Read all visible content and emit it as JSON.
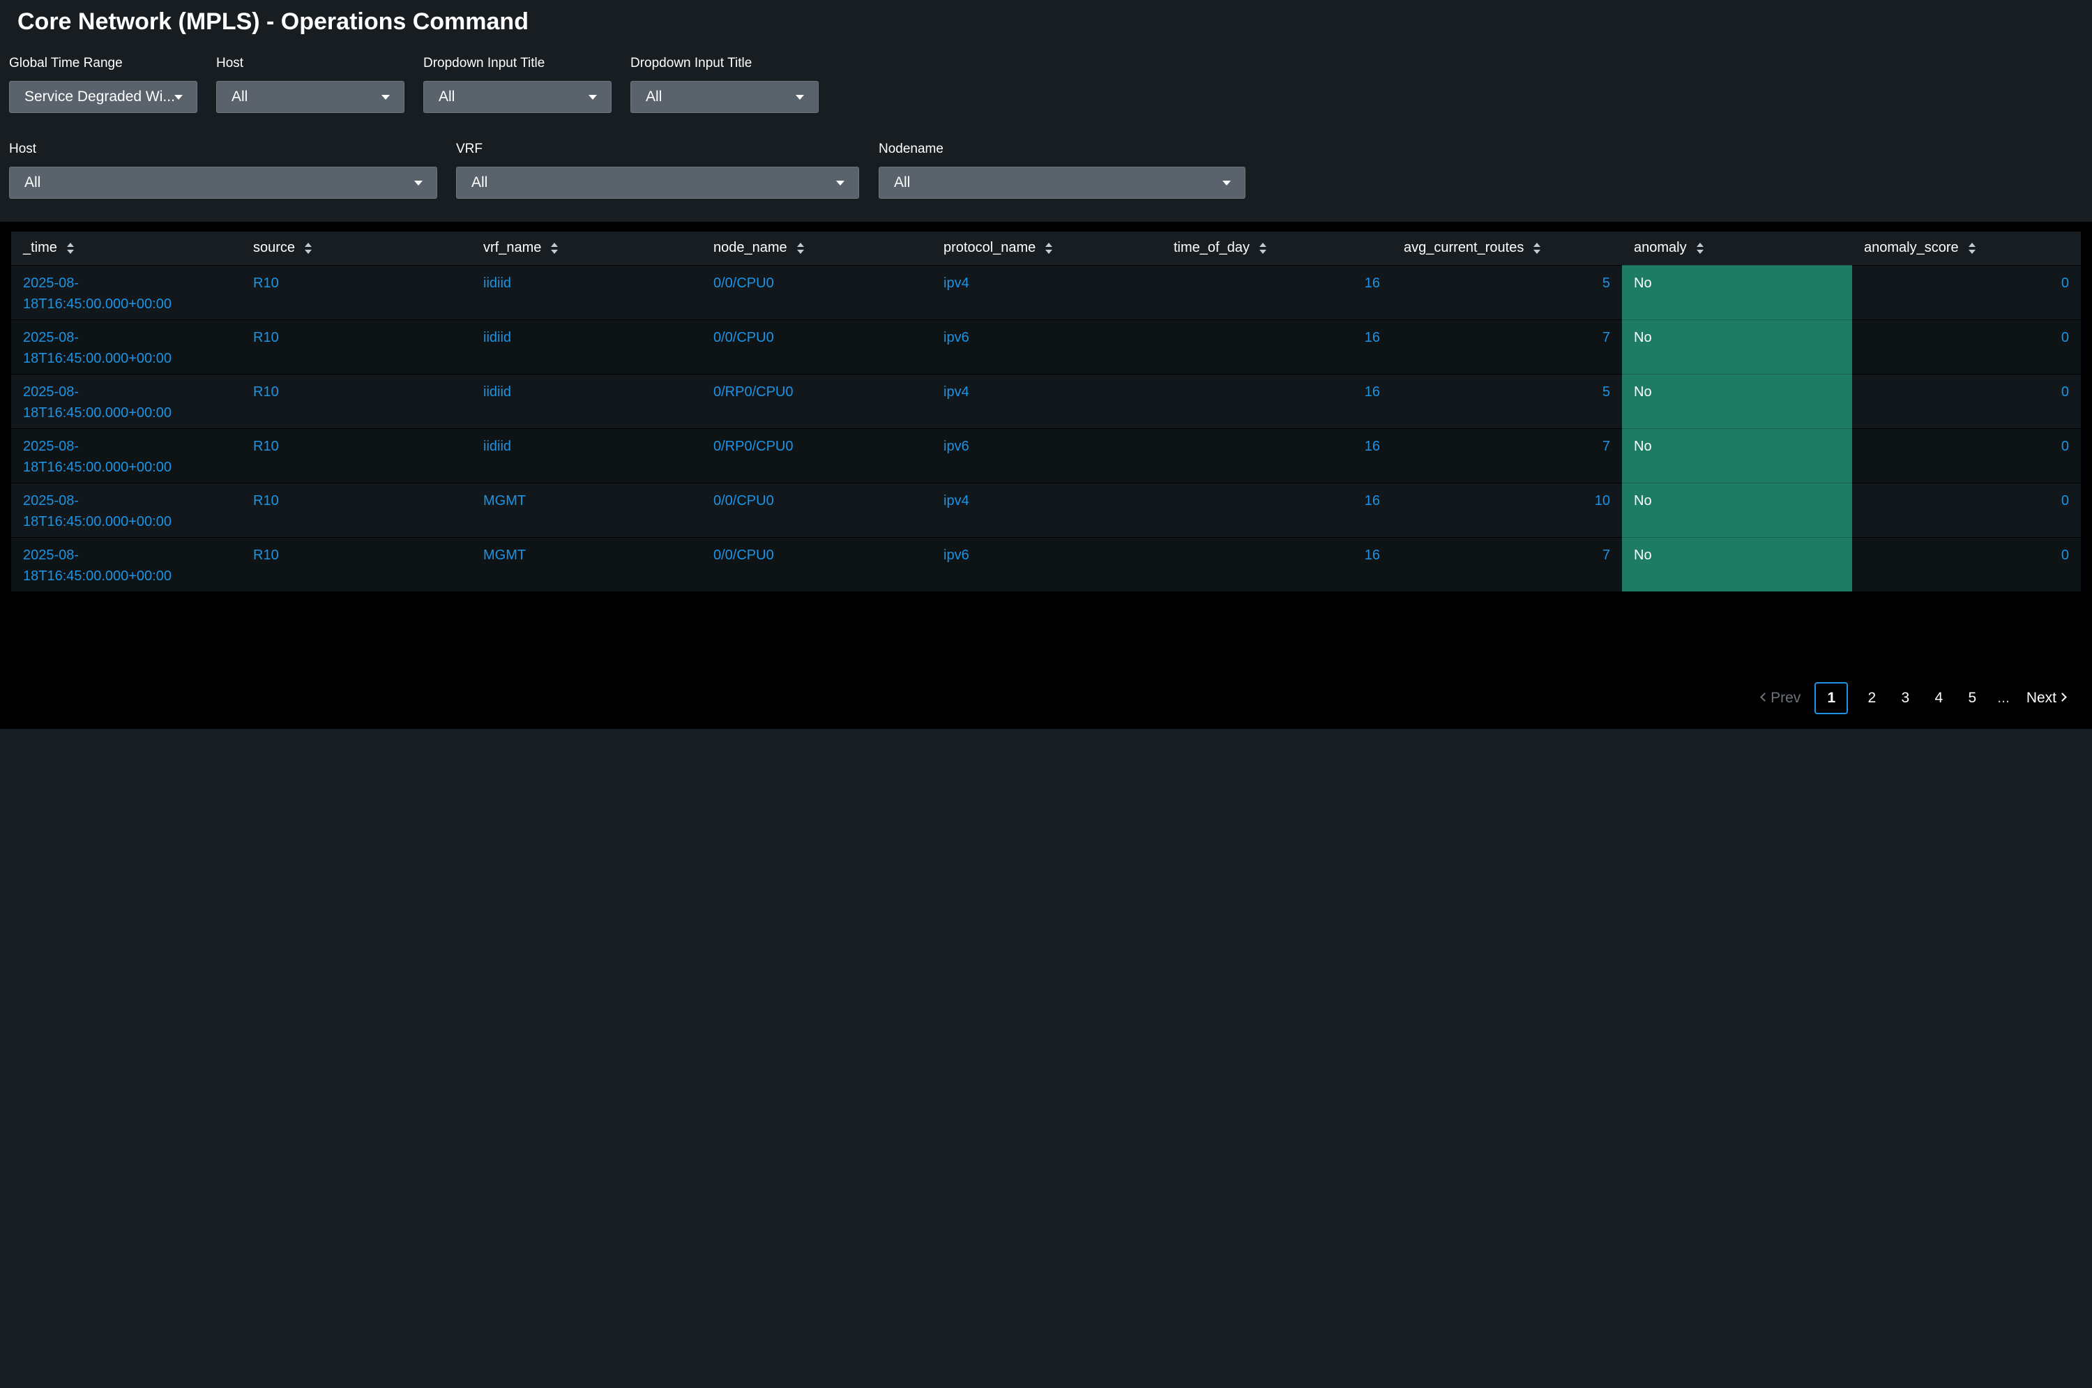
{
  "title": "Core Network (MPLS) - Operations Command",
  "inputs_row1": [
    {
      "label": "Global Time Range",
      "value": "Service Degraded Wi..."
    },
    {
      "label": "Host",
      "value": "All"
    },
    {
      "label": "Dropdown Input Title",
      "value": "All"
    },
    {
      "label": "Dropdown Input Title",
      "value": "All"
    }
  ],
  "inputs_row2": [
    {
      "label": "Host",
      "value": "All"
    },
    {
      "label": "VRF",
      "value": "All"
    },
    {
      "label": "Nodename",
      "value": "All"
    }
  ],
  "table": {
    "columns": [
      "_time",
      "source",
      "vrf_name",
      "node_name",
      "protocol_name",
      "time_of_day",
      "avg_current_routes",
      "anomaly",
      "anomaly_score"
    ],
    "rows": [
      {
        "time_a": "2025-08-",
        "time_b": "18T16:45:00.000+00:00",
        "source": "R10",
        "vrf_name": "iidiid",
        "node_name": "0/0/CPU0",
        "protocol_name": "ipv4",
        "time_of_day": "16",
        "avg_current_routes": "5",
        "anomaly": "No",
        "anomaly_score": "0"
      },
      {
        "time_a": "2025-08-",
        "time_b": "18T16:45:00.000+00:00",
        "source": "R10",
        "vrf_name": "iidiid",
        "node_name": "0/0/CPU0",
        "protocol_name": "ipv6",
        "time_of_day": "16",
        "avg_current_routes": "7",
        "anomaly": "No",
        "anomaly_score": "0"
      },
      {
        "time_a": "2025-08-",
        "time_b": "18T16:45:00.000+00:00",
        "source": "R10",
        "vrf_name": "iidiid",
        "node_name": "0/RP0/CPU0",
        "protocol_name": "ipv4",
        "time_of_day": "16",
        "avg_current_routes": "5",
        "anomaly": "No",
        "anomaly_score": "0"
      },
      {
        "time_a": "2025-08-",
        "time_b": "18T16:45:00.000+00:00",
        "source": "R10",
        "vrf_name": "iidiid",
        "node_name": "0/RP0/CPU0",
        "protocol_name": "ipv6",
        "time_of_day": "16",
        "avg_current_routes": "7",
        "anomaly": "No",
        "anomaly_score": "0"
      },
      {
        "time_a": "2025-08-",
        "time_b": "18T16:45:00.000+00:00",
        "source": "R10",
        "vrf_name": "MGMT",
        "node_name": "0/0/CPU0",
        "protocol_name": "ipv4",
        "time_of_day": "16",
        "avg_current_routes": "10",
        "anomaly": "No",
        "anomaly_score": "0"
      },
      {
        "time_a": "2025-08-",
        "time_b": "18T16:45:00.000+00:00",
        "source": "R10",
        "vrf_name": "MGMT",
        "node_name": "0/0/CPU0",
        "protocol_name": "ipv6",
        "time_of_day": "16",
        "avg_current_routes": "7",
        "anomaly": "No",
        "anomaly_score": "0"
      }
    ]
  },
  "pagination": {
    "prev": "Prev",
    "pages": [
      "1",
      "2",
      "3",
      "4",
      "5"
    ],
    "ellipsis": "...",
    "next": "Next",
    "current": "1"
  },
  "colors": {
    "background": "#171d21",
    "panel": "#000000",
    "link": "#1e93e3",
    "anomaly_ok": "#1f7c64",
    "dropdown": "#5a626c"
  }
}
